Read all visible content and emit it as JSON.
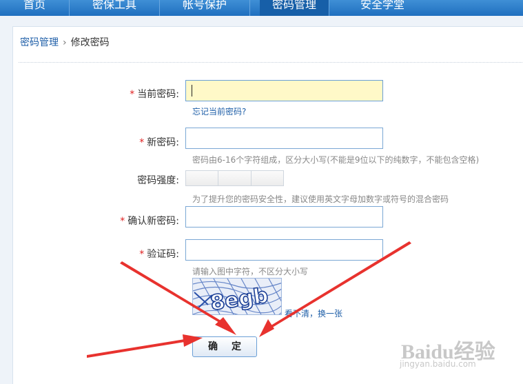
{
  "nav": {
    "tabs": [
      {
        "label": "首页"
      },
      {
        "label": "密保工具"
      },
      {
        "label": "帐号保护"
      },
      {
        "label": "密码管理"
      },
      {
        "label": "安全学堂"
      }
    ]
  },
  "breadcrumb": {
    "parent": "密码管理",
    "separator": "›",
    "current": "修改密码"
  },
  "form": {
    "required_mark": "*",
    "current_password": {
      "label": "当前密码:",
      "value": "",
      "forgot_link": "忘记当前密码?"
    },
    "new_password": {
      "label": "新密码:",
      "value": "",
      "hint": "密码由6-16个字符组成，区分大小写(不能是9位以下的纯数字，不能包含空格)"
    },
    "strength": {
      "label": "密码强度:",
      "hint": "为了提升您的密码安全性，建议使用英文字母加数字或符号的混合密码"
    },
    "confirm_password": {
      "label": "确认新密码:",
      "value": ""
    },
    "captcha": {
      "label": "验证码:",
      "value": "",
      "hint": "请输入图中字符，不区分大小写",
      "image_text": "8egb",
      "cant_see": "看不清，",
      "refresh_link": "换一张"
    },
    "submit_label": "确定"
  },
  "watermark": {
    "text": "Baidu经验",
    "sub": "jingyan.baidu.com"
  },
  "colors": {
    "nav": "#2a7fcf",
    "link": "#1f5fa8",
    "required": "#e02020",
    "focus_fill": "#fff9c8",
    "annotation_arrow": "#e8322e"
  }
}
